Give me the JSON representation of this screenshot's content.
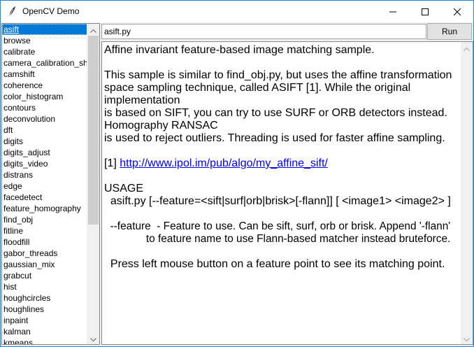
{
  "window": {
    "title": "OpenCV Demo",
    "controls": {
      "minimize_icon": "minimize-icon",
      "maximize_icon": "maximize-icon",
      "close_icon": "close-icon"
    }
  },
  "sidebar": {
    "items": [
      {
        "label": "asift",
        "selected": true
      },
      {
        "label": "browse"
      },
      {
        "label": "calibrate"
      },
      {
        "label": "camera_calibration_sho"
      },
      {
        "label": "camshift"
      },
      {
        "label": "coherence"
      },
      {
        "label": "color_histogram"
      },
      {
        "label": "contours"
      },
      {
        "label": "deconvolution"
      },
      {
        "label": "dft"
      },
      {
        "label": "digits"
      },
      {
        "label": "digits_adjust"
      },
      {
        "label": "digits_video"
      },
      {
        "label": "distrans"
      },
      {
        "label": "edge"
      },
      {
        "label": "facedetect"
      },
      {
        "label": "feature_homography"
      },
      {
        "label": "find_obj"
      },
      {
        "label": "fitline"
      },
      {
        "label": "floodfill"
      },
      {
        "label": "gabor_threads"
      },
      {
        "label": "gaussian_mix"
      },
      {
        "label": "grabcut"
      },
      {
        "label": "hist"
      },
      {
        "label": "houghcircles"
      },
      {
        "label": "houghlines"
      },
      {
        "label": "inpaint"
      },
      {
        "label": "kalman"
      },
      {
        "label": "kmeans"
      }
    ]
  },
  "toolbar": {
    "filename_value": "asift.py",
    "run_label": "Run"
  },
  "description": {
    "lines": [
      "Affine invariant feature-based image matching sample.",
      "",
      "This sample is similar to find_obj.py, but uses the affine transformation",
      "space sampling technique, called ASIFT [1]. While the original",
      "implementation",
      "is based on SIFT, you can try to use SURF or ORB detectors instead.",
      "Homography RANSAC",
      "is used to reject outliers. Threading is used for faster affine sampling.",
      "",
      "",
      "",
      "USAGE",
      "  asift.py [--feature=<sift|surf|orb|brisk>[-flann]] [ <image1> <image2> ]",
      "",
      "  --feature  - Feature to use. Can be sift, surf, orb or brisk. Append '-flann'",
      "              to feature name to use Flann-based matcher instead bruteforce.",
      "",
      "  Press left mouse button on a feature point to see its matching point."
    ],
    "ref_prefix": "[1] ",
    "ref_link": "http://www.ipol.im/pub/algo/my_affine_sift/"
  },
  "colors": {
    "selection": "#0078d7",
    "link": "#0000ee",
    "window_border": "#1883d7"
  }
}
